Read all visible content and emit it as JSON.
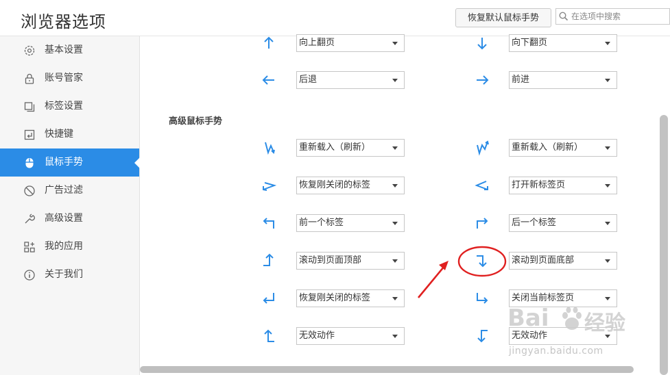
{
  "header": {
    "title": "浏览器选项",
    "restore_button": "恢复默认鼠标手势",
    "search_placeholder": "在选项中搜索"
  },
  "sidebar": {
    "items": [
      {
        "label": "基本设置",
        "icon": "gear-icon",
        "active": false
      },
      {
        "label": "账号管家",
        "icon": "lock-icon",
        "active": false
      },
      {
        "label": "标签设置",
        "icon": "tabs-icon",
        "active": false
      },
      {
        "label": "快捷键",
        "icon": "keyboard-icon",
        "active": false
      },
      {
        "label": "鼠标手势",
        "icon": "mouse-icon",
        "active": true
      },
      {
        "label": "广告过滤",
        "icon": "block-icon",
        "active": false
      },
      {
        "label": "高级设置",
        "icon": "wrench-icon",
        "active": false
      },
      {
        "label": "我的应用",
        "icon": "apps-icon",
        "active": false
      },
      {
        "label": "关于我们",
        "icon": "info-icon",
        "active": false
      }
    ]
  },
  "basic_gestures": [
    {
      "left_gesture": "arrow-up",
      "left_action": "向上翻页",
      "right_gesture": "arrow-down",
      "right_action": "向下翻页"
    },
    {
      "left_gesture": "arrow-left",
      "left_action": "后退",
      "right_gesture": "arrow-right",
      "right_action": "前进"
    }
  ],
  "advanced_title": "高级鼠标手势",
  "advanced_gestures": [
    {
      "left_gesture": "up-down-zigzag",
      "left_action": "重新载入（刷新）",
      "right_gesture": "down-up-zigzag",
      "right_action": "重新载入（刷新）"
    },
    {
      "left_gesture": "right-left-angle",
      "left_action": "恢复刚关闭的标签",
      "right_gesture": "left-right-angle",
      "right_action": "打开新标签页"
    },
    {
      "left_gesture": "up-left",
      "left_action": "前一个标签",
      "right_gesture": "up-right",
      "right_action": "后一个标签"
    },
    {
      "left_gesture": "right-up",
      "left_action": "滚动到页面顶部",
      "right_gesture": "right-down",
      "right_action": "滚动到页面底部"
    },
    {
      "left_gesture": "down-left",
      "left_action": "恢复刚关闭的标签",
      "right_gesture": "down-right",
      "right_action": "关闭当前标签页"
    },
    {
      "left_gesture": "left-up",
      "left_action": "无效动作",
      "right_gesture": "left-down",
      "right_action": "无效动作"
    }
  ],
  "watermark": {
    "brand_left": "Bai",
    "brand_right": "经验",
    "url": "jingyan.baidu.com"
  },
  "colors": {
    "accent": "#2b8ce6",
    "gesture": "#2b8ce6",
    "annotation": "#e02020"
  }
}
